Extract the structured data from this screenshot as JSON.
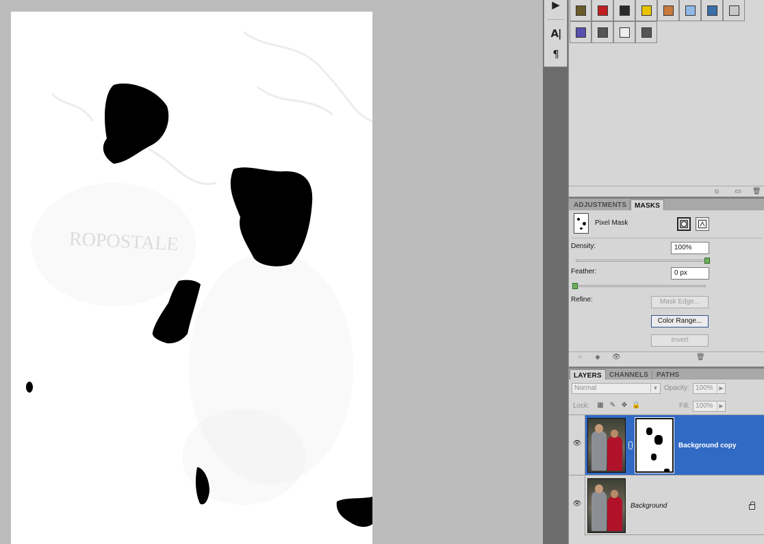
{
  "tools_strip": {
    "items": [
      "play-icon",
      "character-icon",
      "paragraph-icon"
    ],
    "glyphs": {
      "play": "▶",
      "character": "A|",
      "paragraph": "¶"
    }
  },
  "styles_panel": {
    "swatches": [
      {
        "name": "style-swatch-1",
        "color": "#6b5a2b"
      },
      {
        "name": "style-swatch-2",
        "color": "#c02020"
      },
      {
        "name": "style-swatch-3",
        "color": "#2a2a2a"
      },
      {
        "name": "style-swatch-4",
        "color": "#e8c400"
      },
      {
        "name": "style-swatch-5",
        "color": "#c77a3a"
      },
      {
        "name": "style-swatch-6",
        "color": "#8fb8e6"
      },
      {
        "name": "style-swatch-7",
        "color": "#3a6ea8"
      },
      {
        "name": "style-swatch-8",
        "color": "#c8c8c8"
      },
      {
        "name": "style-swatch-9",
        "color": "#5a4fb0"
      },
      {
        "name": "style-swatch-10",
        "color": "#555555"
      },
      {
        "name": "style-swatch-11",
        "color": "#eeeeee"
      },
      {
        "name": "style-swatch-12",
        "color": "#555555"
      }
    ]
  },
  "adjust_tabs": {
    "tab1": "ADJUSTMENTS",
    "tab2": "MASKS"
  },
  "masks": {
    "title": "Pixel Mask",
    "density_label": "Density:",
    "density_value": "100%",
    "density_level": 1.0,
    "feather_label": "Feather:",
    "feather_value": "0 px",
    "feather_level": 0.0,
    "refine_label": "Refine:",
    "mask_edge": "Mask Edge...",
    "color_range": "Color Range...",
    "invert": "Invert"
  },
  "layers_tabs": {
    "tab1": "LAYERS",
    "tab2": "CHANNELS",
    "tab3": "PATHS"
  },
  "layers_panel": {
    "blend_mode": "Normal",
    "opacity_label": "Opacity:",
    "opacity_value": "100%",
    "lock_label": "Lock:",
    "fill_label": "Fill:",
    "fill_value": "100%",
    "layers": [
      {
        "name": "Background copy",
        "selected": true,
        "has_mask": true
      },
      {
        "name": "Background",
        "selected": false,
        "locked": true
      }
    ]
  },
  "colors": {
    "selection": "#316ac5",
    "panel_bg": "#d6d6d6",
    "workspace": "#bcbcbc"
  }
}
